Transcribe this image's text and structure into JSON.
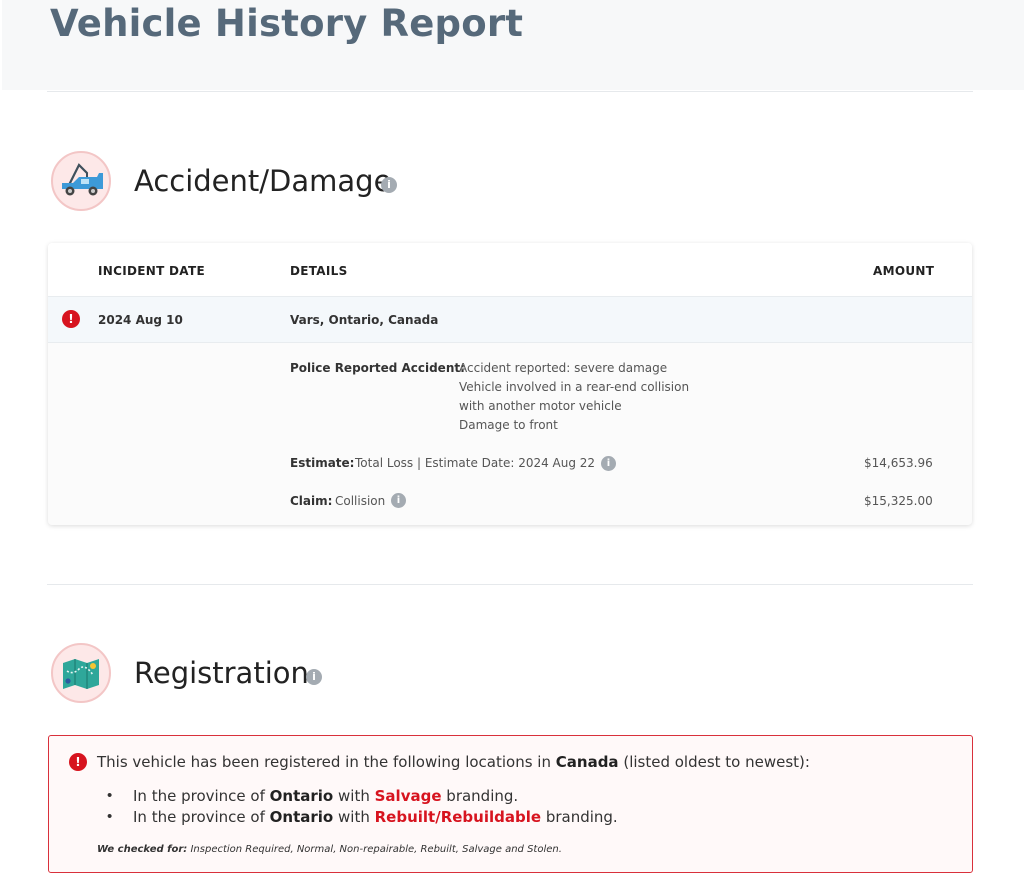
{
  "report": {
    "title": "Vehicle History Report"
  },
  "accident": {
    "title": "Accident/Damage",
    "icon": "tow-truck-icon",
    "columns": {
      "date": "INCIDENT DATE",
      "details": "DETAILS",
      "amount": "AMOUNT"
    },
    "incident": {
      "date": "2024 Aug 10",
      "location": "Vars, Ontario, Canada",
      "police_label": "Police Reported Accident:",
      "police_lines": [
        "Accident reported: severe damage",
        "Vehicle involved in a rear-end collision",
        "with another motor vehicle",
        "Damage to front"
      ],
      "estimate_label": "Estimate:",
      "estimate_value": "Total Loss | Estimate Date: 2024 Aug 22",
      "estimate_amount": "$14,653.96",
      "claim_label": "Claim:",
      "claim_value": "Collision",
      "claim_amount": "$15,325.00"
    }
  },
  "registration": {
    "title": "Registration",
    "icon": "map-icon",
    "intro_pre": "This vehicle has been registered in the following locations in",
    "intro_country": "Canada",
    "intro_post": "(listed oldest to newest):",
    "items": [
      {
        "pre": "In the province of",
        "province": "Ontario",
        "mid": "with",
        "brand": "Salvage",
        "post": "branding."
      },
      {
        "pre": "In the province of",
        "province": "Ontario",
        "mid": "with",
        "brand": "Rebuilt/Rebuildable",
        "post": "branding."
      }
    ],
    "checked_label": "We checked for:",
    "checked_list": "Inspection Required, Normal, Non-repairable, Rebuilt, Salvage and Stolen."
  },
  "colors": {
    "accent_red": "#d7141f",
    "title_slate": "#56697a"
  }
}
